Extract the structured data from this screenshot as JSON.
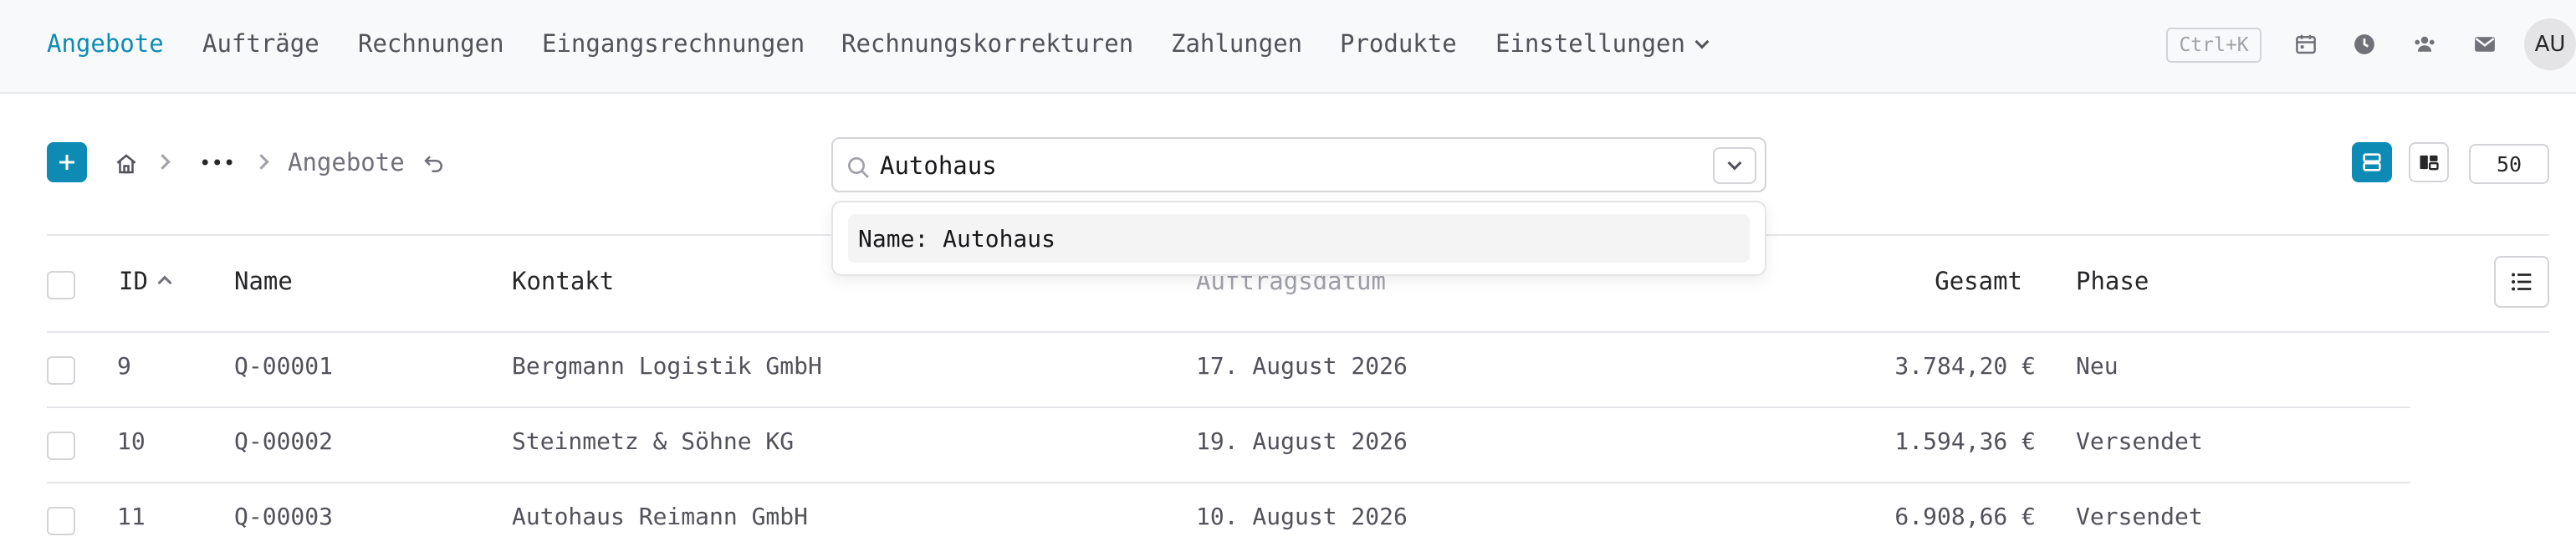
{
  "nav": {
    "items": [
      "Angebote",
      "Aufträge",
      "Rechnungen",
      "Eingangsrechnungen",
      "Rechnungskorrekturen",
      "Zahlungen",
      "Produkte"
    ],
    "settings_label": "Einstellungen",
    "shortcut": "Ctrl+K",
    "avatar_initials": "AU"
  },
  "breadcrumb": {
    "ellipsis": "•••",
    "current": "Angebote"
  },
  "search": {
    "value": "Autohaus",
    "suggestion": "Name: Autohaus"
  },
  "toolbar": {
    "page_size": "50"
  },
  "table": {
    "headers": {
      "id": "ID",
      "name": "Name",
      "contact": "Kontakt",
      "order_date": "Auftragsdatum",
      "total": "Gesamt",
      "phase": "Phase"
    },
    "rows": [
      {
        "id": "9",
        "name": "Q-00001",
        "contact": "Bergmann Logistik GmbH",
        "order_date": "17. August 2026",
        "total": "3.784,20 €",
        "phase": "Neu"
      },
      {
        "id": "10",
        "name": "Q-00002",
        "contact": "Steinmetz & Söhne KG",
        "order_date": "19. August 2026",
        "total": "1.594,36 €",
        "phase": "Versendet"
      },
      {
        "id": "11",
        "name": "Q-00003",
        "contact": "Autohaus Reimann GmbH",
        "order_date": "10. August 2026",
        "total": "6.908,66 €",
        "phase": "Versendet"
      }
    ]
  },
  "colors": {
    "accent": "#0e8bb4",
    "text": "#3f3f46",
    "border": "#d4d4d8"
  },
  "icons": [
    "calendar-icon",
    "clock-icon",
    "users-icon",
    "mail-icon",
    "home-icon",
    "undo-icon",
    "search-icon",
    "list-icon",
    "kanban-icon",
    "columns-icon"
  ]
}
